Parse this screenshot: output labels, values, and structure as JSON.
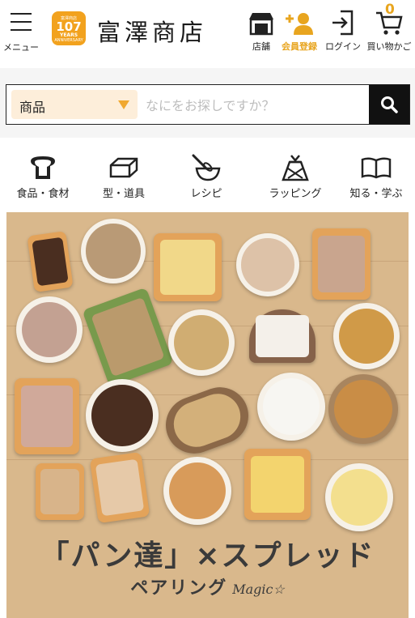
{
  "header": {
    "menu_label": "メニュー",
    "badge": {
      "top": "富澤商店",
      "number": "107",
      "years": "YEARS",
      "sub": "ANNIVERSARY"
    },
    "brand": "富澤商店",
    "store_label": "店舗",
    "member_label": "会員登録",
    "login_label": "ログイン",
    "cart_label": "買い物かご",
    "cart_count": "0",
    "accent_color": "#e8a51f"
  },
  "search": {
    "category": "商品",
    "placeholder": "なにをお探しですか？"
  },
  "categories": [
    {
      "label": "食品・食材",
      "icon": "bread-icon"
    },
    {
      "label": "型・道具",
      "icon": "baking-pan-icon"
    },
    {
      "label": "レシピ",
      "icon": "whisk-bowl-icon"
    },
    {
      "label": "ラッピング",
      "icon": "gift-bag-icon"
    },
    {
      "label": "知る・学ぶ",
      "icon": "open-book-icon"
    }
  ],
  "banner": {
    "title": "「パン達」×スプレッド",
    "subtitle": "ペアリング",
    "subtitle_script": "Magic☆"
  }
}
